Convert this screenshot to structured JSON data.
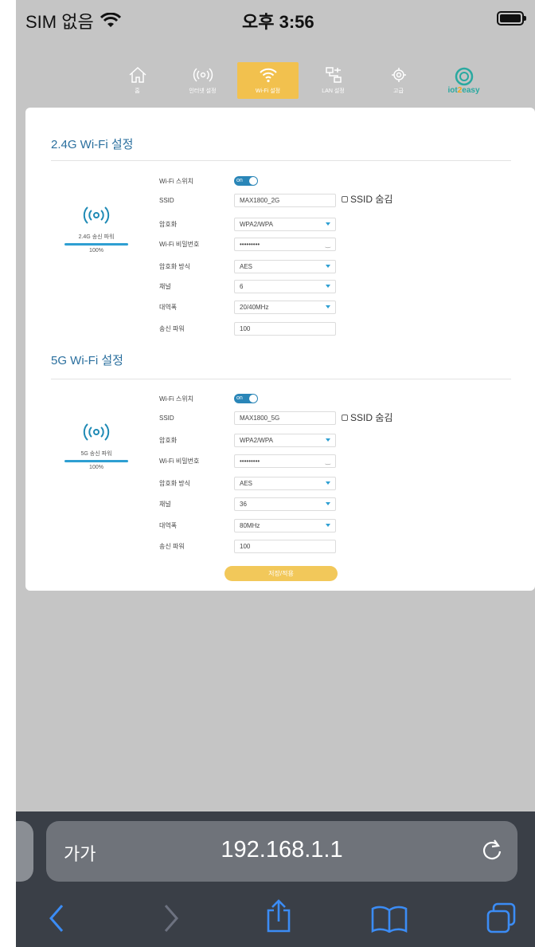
{
  "status_bar": {
    "carrier": "SIM 없음",
    "time": "오후 3:56"
  },
  "router_nav": {
    "items": [
      {
        "label": "홈",
        "icon": "home-icon",
        "active": false
      },
      {
        "label": "인터넷 설정",
        "icon": "signal-icon",
        "active": false
      },
      {
        "label": "Wi-Fi 설정",
        "icon": "wifi-icon",
        "active": true
      },
      {
        "label": "LAN 설정",
        "icon": "lan-icon",
        "active": false
      },
      {
        "label": "고급",
        "icon": "gear-icon",
        "active": false
      }
    ],
    "logo": {
      "part1": "iot",
      "part2": "2",
      "part3": "easy"
    }
  },
  "wifi_24": {
    "title": "2.4G Wi-Fi 설정",
    "power_label": "2.4G 송신 파워",
    "power_value": "100%",
    "power_level": 1.0,
    "rows": {
      "switch_label": "Wi-Fi 스위치",
      "switch_value": "on",
      "ssid_label": "SSID",
      "ssid_value": "MAX1800_2G",
      "hide_ssid_label": "SSID 숨김",
      "encryption_label": "암호화",
      "encryption_value": "WPA2/WPA",
      "password_label": "Wi-Fi 비밀번호",
      "password_value": "•••••••••",
      "cipher_label": "암호화 방식",
      "cipher_value": "AES",
      "channel_label": "채널",
      "channel_value": "6",
      "bandwidth_label": "대역폭",
      "bandwidth_value": "20/40MHz",
      "txpower_label": "송신 파워",
      "txpower_value": "100"
    }
  },
  "wifi_5": {
    "title": "5G Wi-Fi 설정",
    "power_label": "5G 송신 파워",
    "power_value": "100%",
    "power_level": 1.0,
    "rows": {
      "switch_label": "Wi-Fi 스위치",
      "switch_value": "on",
      "ssid_label": "SSID",
      "ssid_value": "MAX1800_5G",
      "hide_ssid_label": "SSID 숨김",
      "encryption_label": "암호화",
      "encryption_value": "WPA2/WPA",
      "password_label": "Wi-Fi 비밀번호",
      "password_value": "•••••••••",
      "cipher_label": "암호화 방식",
      "cipher_value": "AES",
      "channel_label": "채널",
      "channel_value": "36",
      "bandwidth_label": "대역폭",
      "bandwidth_value": "80MHz",
      "txpower_label": "송신 파워",
      "txpower_value": "100"
    }
  },
  "save_button": "저장/적용",
  "browser": {
    "text_size": "가가",
    "url": "192.168.1.1"
  },
  "colors": {
    "accent": "#f2c14e",
    "link_blue": "#2a6f9e",
    "toggle": "#2a86b8",
    "ios_blue": "#3b8cf5"
  }
}
